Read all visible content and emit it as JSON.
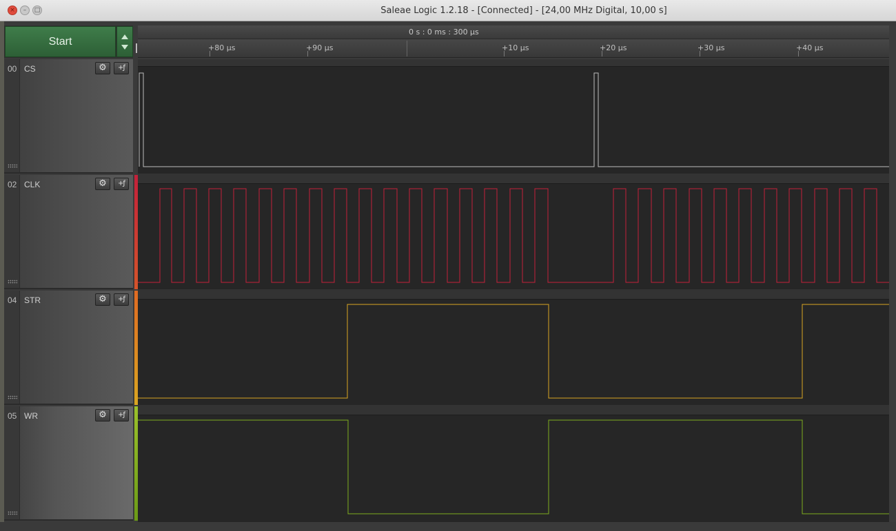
{
  "window": {
    "title": "Saleae Logic 1.2.18 - [Connected] - [24,00 MHz Digital, 10,00 s]",
    "close_glyph": "×",
    "minimize_glyph": "–",
    "maximize_glyph": "□"
  },
  "controls": {
    "start_label": "Start",
    "arrow_up_icon": "triangle-up-icon",
    "arrow_down_icon": "triangle-down-icon"
  },
  "timeline": {
    "reference_time": "0 s : 0 ms : 300 µs",
    "ticks": [
      "+80 µs",
      "+90 µs",
      "+10 µs",
      "+20 µs",
      "+30 µs",
      "+40 µs"
    ]
  },
  "channels": [
    {
      "index": "00",
      "name": "CS",
      "color": "#bfbfbf",
      "settings_icon": "gear-icon",
      "trigger_icon": "trigger-icon",
      "settings_glyph": "⚙",
      "trigger_glyph": "+ƒ"
    },
    {
      "index": "02",
      "name": "CLK",
      "color": "#c4203a",
      "settings_icon": "gear-icon",
      "trigger_icon": "trigger-icon",
      "settings_glyph": "⚙",
      "trigger_glyph": "+ƒ"
    },
    {
      "index": "04",
      "name": "STR",
      "color": "#d9a521",
      "settings_icon": "gear-icon",
      "trigger_icon": "trigger-icon",
      "settings_glyph": "⚙",
      "trigger_glyph": "+ƒ"
    },
    {
      "index": "05",
      "name": "WR",
      "color": "#7fae1f",
      "settings_icon": "gear-icon",
      "trigger_icon": "trigger-icon",
      "settings_glyph": "⚙",
      "trigger_glyph": "+ƒ"
    }
  ],
  "colors": {
    "start_green": "#3a7644",
    "wave_background": "#262626",
    "bar_colors": [
      "#c4203a",
      "#d4542b",
      "#d9a521",
      "#7fae1f"
    ]
  }
}
